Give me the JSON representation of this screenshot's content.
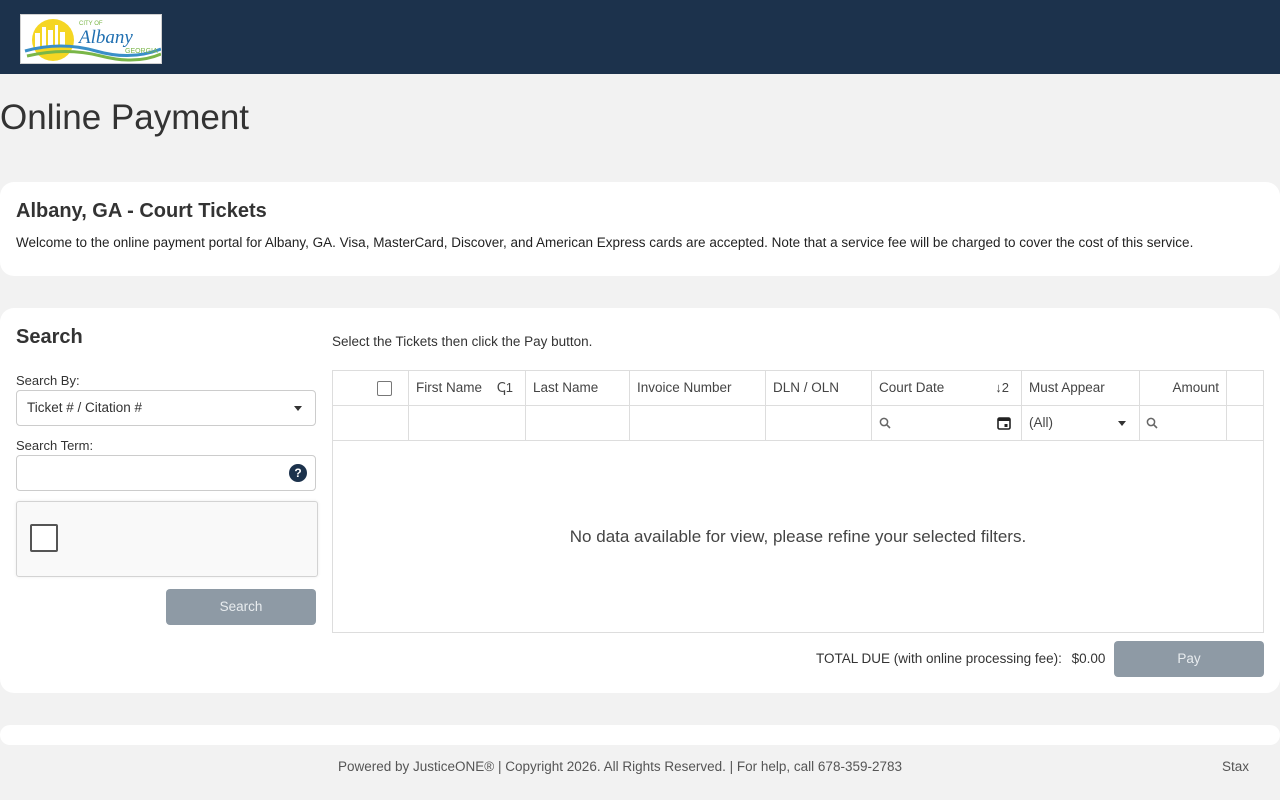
{
  "logo": {
    "small_text": "CITY OF",
    "name": "Albany",
    "state": "GEORGIA"
  },
  "page": {
    "title": "Online Payment"
  },
  "intro": {
    "title": "Albany, GA - Court Tickets",
    "text": "Welcome to the online payment portal for Albany, GA. Visa, MasterCard, Discover, and American Express cards are accepted. Note that a service fee will be charged to cover the cost of this service."
  },
  "search": {
    "title": "Search",
    "by_label": "Search By:",
    "by_value": "Ticket # / Citation #",
    "term_label": "Search Term:",
    "term_value": "",
    "help_glyph": "?",
    "button": "Search"
  },
  "grid": {
    "instructions": "Select the Tickets then click the Pay button.",
    "columns": [
      {
        "label": "First Name",
        "sort": "ↅ1"
      },
      {
        "label": "Last Name",
        "sort": ""
      },
      {
        "label": "Invoice Number",
        "sort": ""
      },
      {
        "label": "DLN / OLN",
        "sort": ""
      },
      {
        "label": "Court Date",
        "sort": "↓2"
      },
      {
        "label": "Must Appear",
        "sort": ""
      },
      {
        "label": "Amount",
        "sort": ""
      }
    ],
    "must_appear_filter": "(All)",
    "empty_message": "No data available for view, please refine your selected filters."
  },
  "totals": {
    "label": "TOTAL DUE (with online processing fee):",
    "amount": "$0.00",
    "pay_button": "Pay"
  },
  "footer": {
    "text": "Powered by JusticeONE® | Copyright 2026. All Rights Reserved. | For help, call 678-359-2783",
    "right": "Stax"
  },
  "colors": {
    "header": "#1c324c",
    "disabled_button": "#8e9aa5",
    "background": "#f2f2f2"
  }
}
